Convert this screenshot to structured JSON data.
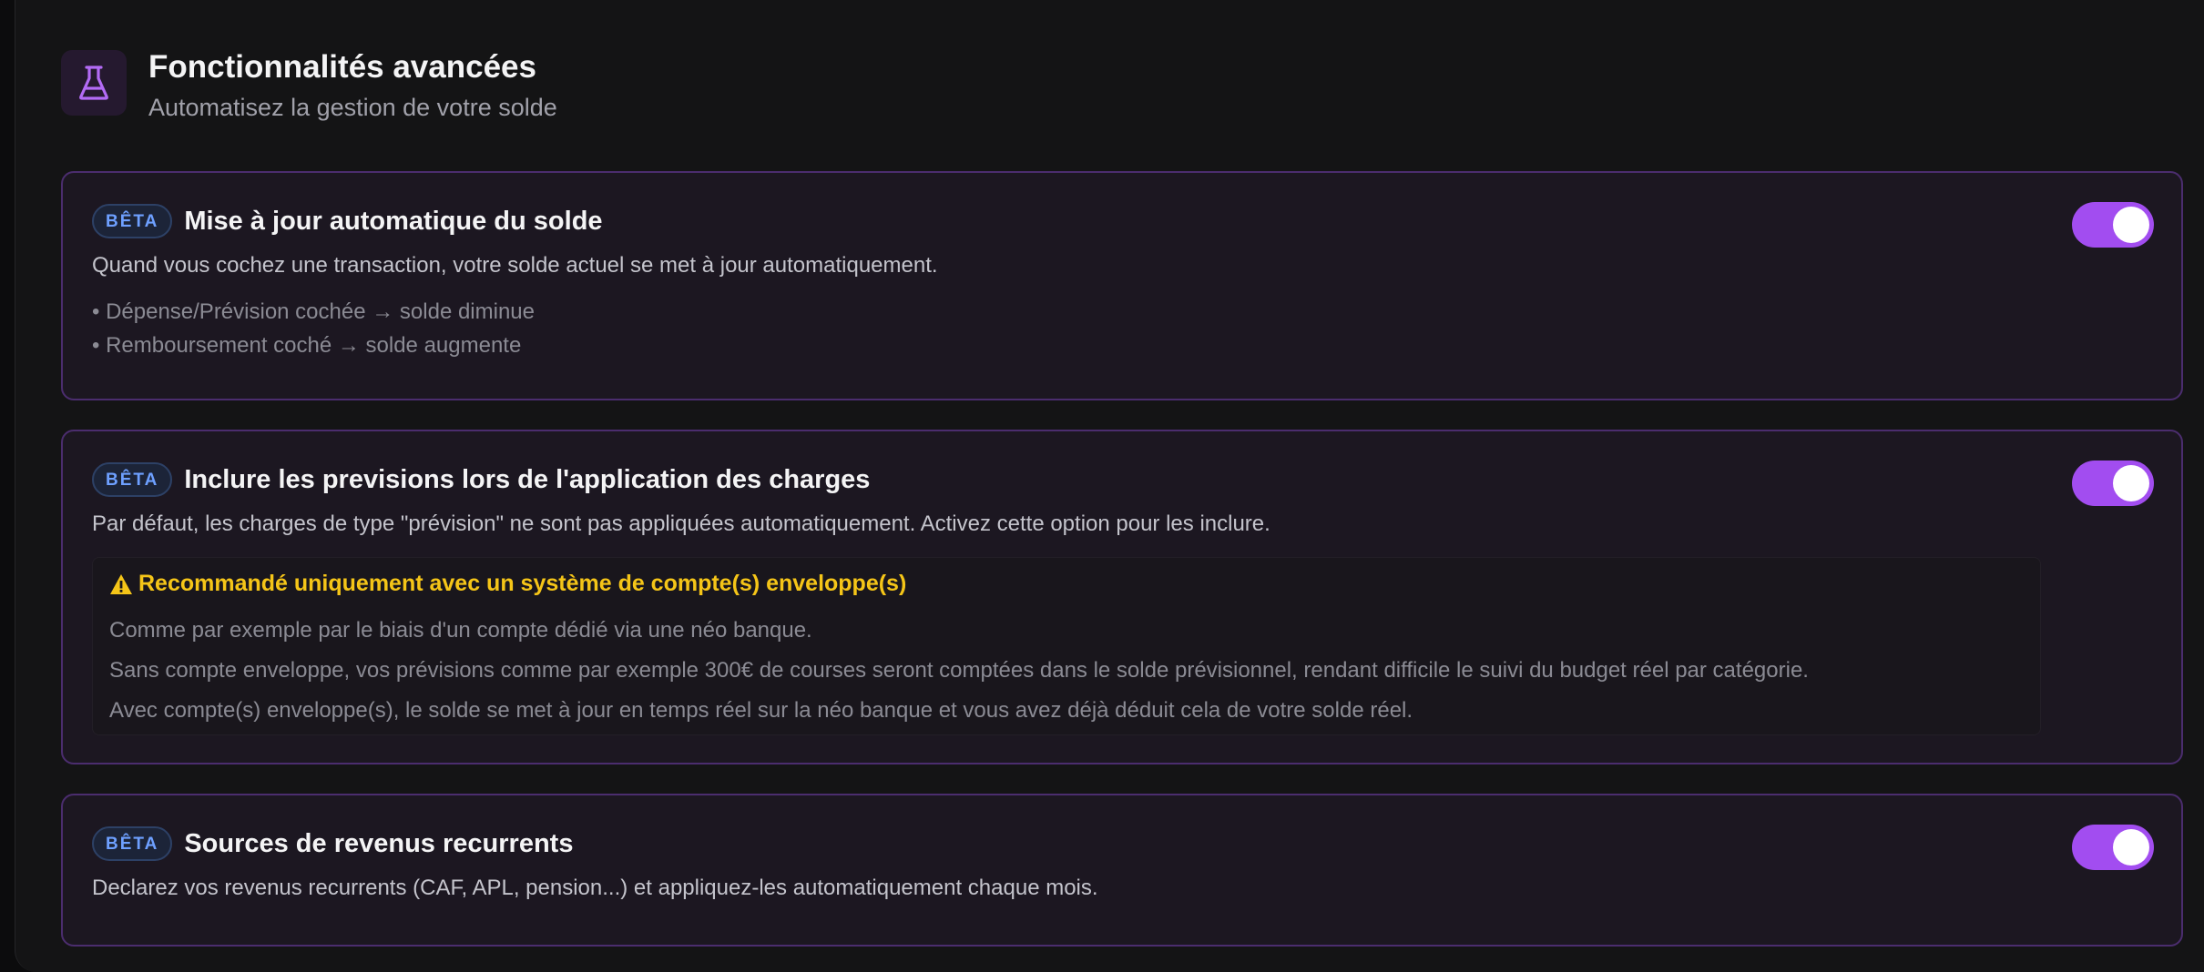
{
  "header": {
    "icon": "flask-icon",
    "title": "Fonctionnalités avancées",
    "subtitle": "Automatisez la gestion de votre solde"
  },
  "colors": {
    "accent": "#a24df0",
    "badge_text": "#6ea0ff",
    "warning": "#f5c518",
    "card_border": "#4b2d6e"
  },
  "cards": [
    {
      "badge": "BÊTA",
      "title": "Mise à jour automatique du solde",
      "description": "Quand vous cochez une transaction, votre solde actuel se met à jour automatiquement.",
      "bullets": [
        "• Dépense/Prévision cochée → solde diminue",
        "• Remboursement coché → solde augmente"
      ],
      "enabled": true
    },
    {
      "badge": "BÊTA",
      "title": "Inclure les previsions lors de l'application des charges",
      "description": "Par défaut, les charges de type \"prévision\" ne sont pas appliquées automatiquement. Activez cette option pour les inclure.",
      "warning": {
        "icon": "warning-icon",
        "title": "Recommandé uniquement avec un système de compte(s) enveloppe(s)",
        "lines": [
          "Comme par exemple par le biais d'un compte dédié via une néo banque.",
          "Sans compte enveloppe, vos prévisions comme par exemple 300€ de courses seront comptées dans le solde prévisionnel, rendant difficile le suivi du budget réel par catégorie.",
          "Avec compte(s) enveloppe(s), le solde se met à jour en temps réel sur la néo banque et vous avez déjà déduit cela de votre solde réel."
        ]
      },
      "enabled": true
    },
    {
      "badge": "BÊTA",
      "title": "Sources de revenus recurrents",
      "description": "Declarez vos revenus recurrents (CAF, APL, pension...) et appliquez-les automatiquement chaque mois.",
      "enabled": true
    }
  ]
}
